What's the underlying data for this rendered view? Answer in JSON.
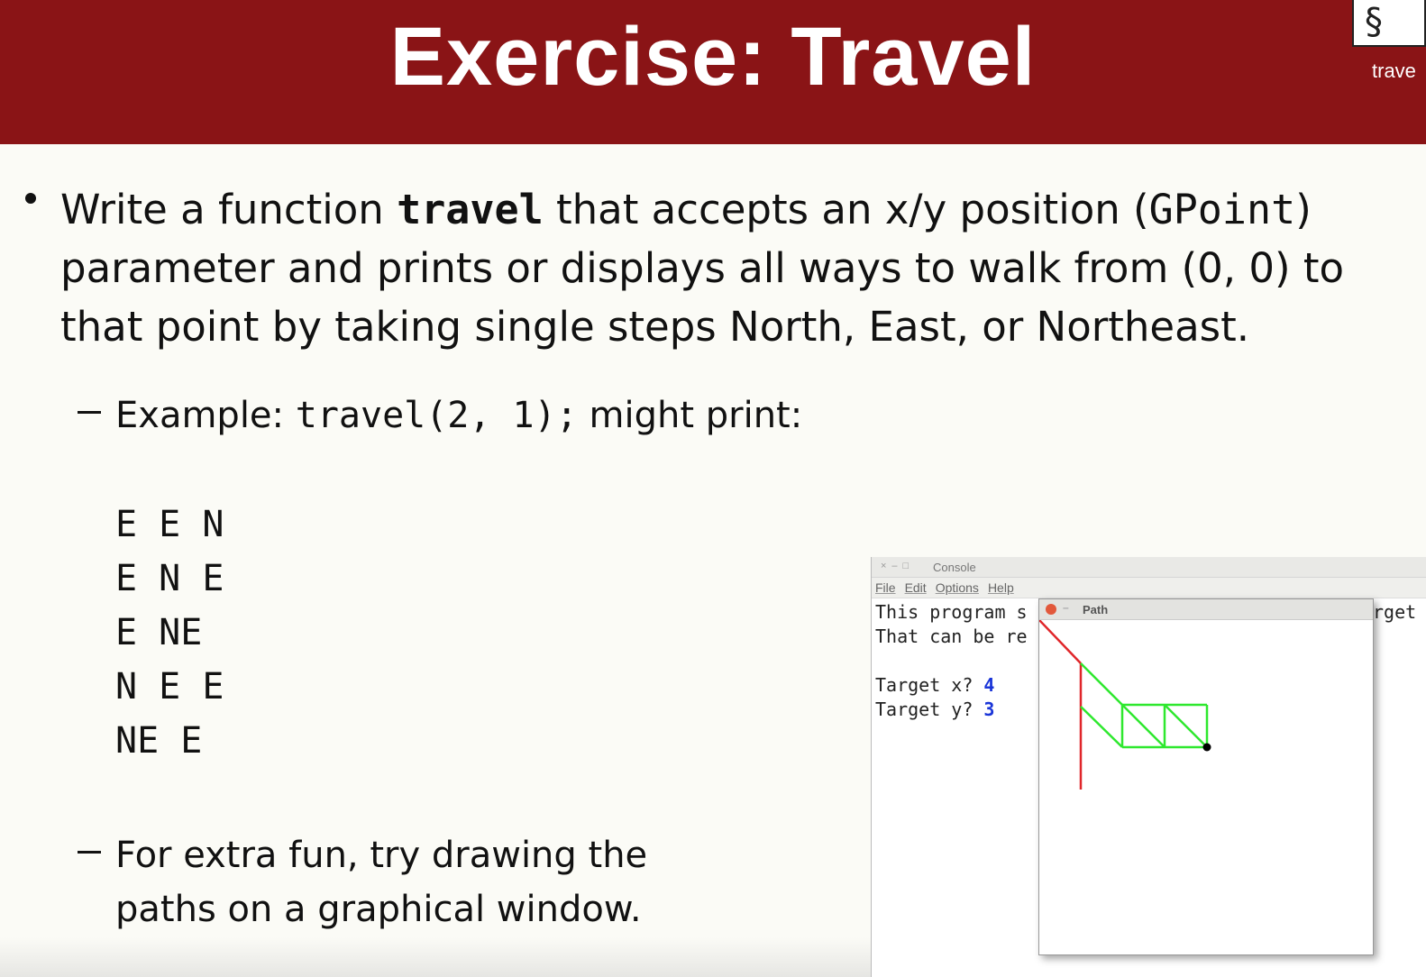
{
  "slide": {
    "title": "Exercise: Travel",
    "logo_text": "trave",
    "bullet": {
      "part1": "Write a function ",
      "code1": "travel",
      "part2": " that accepts an x/y position (",
      "code2": "GPoint",
      "part3": ") parameter and prints or displays all ways to walk from (0, 0) to that point by taking single steps North, East, or Northeast."
    },
    "example": {
      "label": "Example: ",
      "code": "travel(2, 1);",
      "suffix": " might print:"
    },
    "paths": [
      "E E N",
      "E N E",
      "E NE",
      "N E E",
      "NE E"
    ],
    "extra_line1": "For extra fun, try drawing the",
    "extra_line2": "paths on a graphical window."
  },
  "console": {
    "title": "Console",
    "menu": [
      "File",
      "Edit",
      "Options",
      "Help"
    ],
    "line1": "This program s",
    "line2": "That can be re",
    "line1_tail": "rget",
    "prompt_x": "Target x? ",
    "value_x": "4",
    "prompt_y": "Target y? ",
    "value_y": "3"
  },
  "path_window": {
    "title": "Path",
    "colors": {
      "red_path": "#e0262a",
      "green_path": "#2ee82e",
      "end_point": "#000000"
    }
  },
  "colors": {
    "header": "#8a1416",
    "background": "#fbfbf6",
    "input_blue": "#1a35d8"
  }
}
